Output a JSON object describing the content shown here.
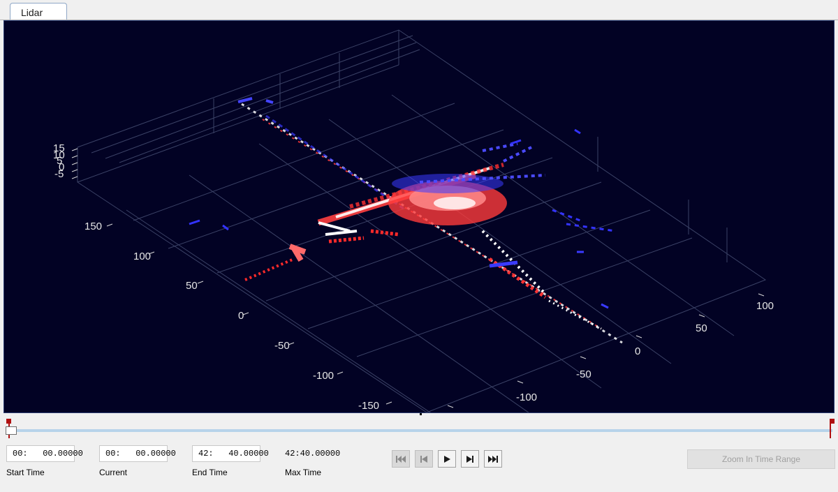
{
  "tabs": [
    {
      "label": "Lidar",
      "active": true
    }
  ],
  "lidar_view": {
    "background": "#020224",
    "axis_ticks": {
      "z": [
        "15",
        "10",
        "5",
        "0",
        "-5"
      ],
      "y": [
        "150",
        "100",
        "50",
        "0",
        "-50",
        "-100",
        "-150"
      ],
      "x": [
        "-100",
        "-50",
        "0",
        "50",
        "100"
      ]
    },
    "point_colors": [
      "#ff2020",
      "#ffffff",
      "#2a2aff"
    ]
  },
  "timeline": {
    "position": 0.0,
    "start_field": "00:   00.00000",
    "current_field": "00:   00.00000",
    "end_field": "42:   40.00000",
    "max_time": "42:40.00000",
    "labels": {
      "start": "Start Time",
      "current": "Current",
      "end": "End Time",
      "max": "Max Time"
    },
    "marker_color": "#b01010"
  },
  "playback": {
    "buttons": [
      {
        "icon": "skip-to-start-icon",
        "enabled": false
      },
      {
        "icon": "step-back-icon",
        "enabled": false
      },
      {
        "icon": "play-icon",
        "enabled": true
      },
      {
        "icon": "step-forward-icon",
        "enabled": true
      },
      {
        "icon": "skip-to-end-icon",
        "enabled": true
      }
    ]
  },
  "zoom_button": {
    "label": "Zoom In Time Range",
    "enabled": false
  }
}
